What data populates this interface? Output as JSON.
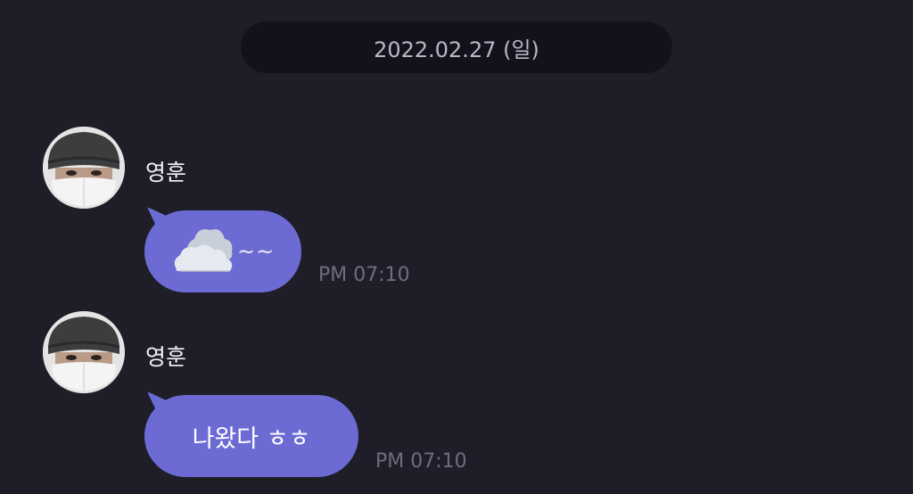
{
  "chat": {
    "date_divider": "2022.02.27 (일)",
    "messages": [
      {
        "sender": "영훈",
        "content_icon": "cloud-icon",
        "text": "~~",
        "time": "PM 07:10"
      },
      {
        "sender": "영훈",
        "text": "나왔다 ㅎㅎ",
        "time": "PM 07:10"
      }
    ]
  },
  "colors": {
    "background": "#1f1e28",
    "date_pill": "#13121a",
    "bubble": "#6c6bd4",
    "time_text": "#6e6c80"
  }
}
